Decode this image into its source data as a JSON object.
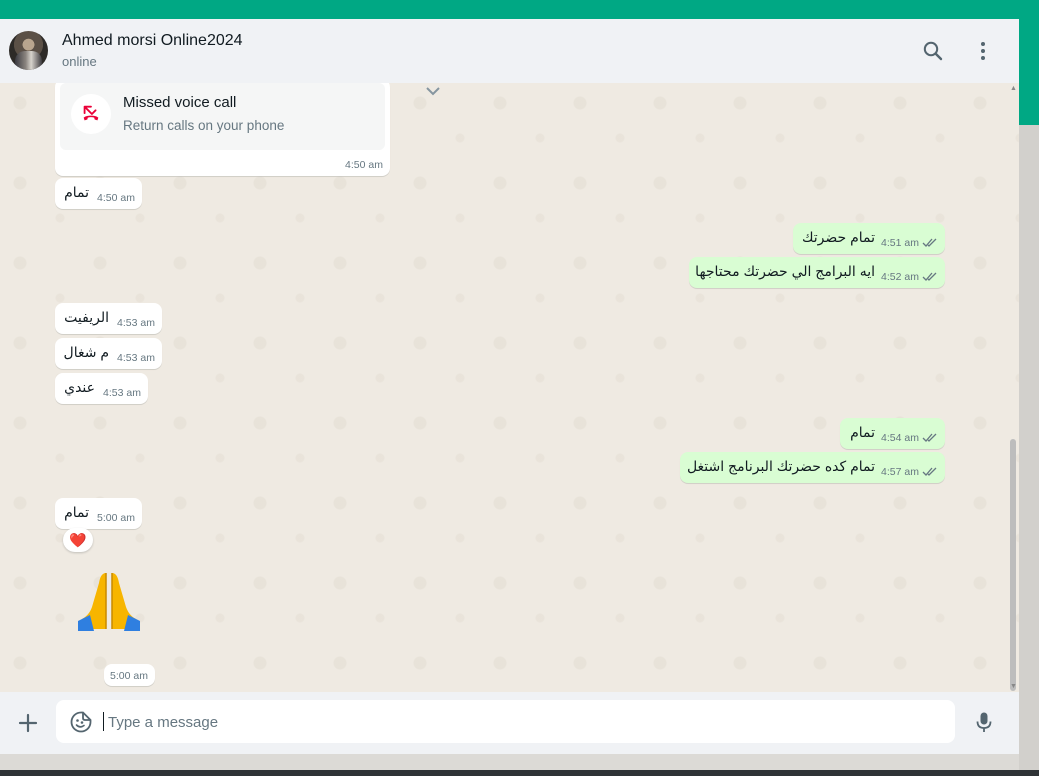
{
  "header": {
    "contact_name": "Ahmed morsi Online2024",
    "status": "online"
  },
  "call": {
    "title": "Missed voice call",
    "subtitle": "Return calls on your phone",
    "time": "4:50 am"
  },
  "messages": [
    {
      "dir": "in",
      "text": "تمام",
      "time": "4:50 am"
    },
    {
      "dir": "out",
      "text": "تمام حضرتك",
      "time": "4:51 am"
    },
    {
      "dir": "out",
      "text": "ايه البرامج الي حضرتك محتاجها",
      "time": "4:52 am"
    },
    {
      "dir": "in",
      "text": "الريفيت",
      "time": "4:53 am"
    },
    {
      "dir": "in",
      "text": "م شغال",
      "time": "4:53 am"
    },
    {
      "dir": "in",
      "text": "عندي",
      "time": "4:53 am"
    },
    {
      "dir": "out",
      "text": "تمام",
      "time": "4:54 am"
    },
    {
      "dir": "out",
      "text": "تمام كده حضرتك البرنامج اشتغل",
      "time": "4:57 am"
    },
    {
      "dir": "in",
      "text": "تمام",
      "time": "5:00 am"
    },
    {
      "dir": "in",
      "text": "",
      "time": "5:00 am"
    }
  ],
  "reaction": "❤️",
  "composer": {
    "placeholder": "Type a message"
  },
  "colors": {
    "accent": "#00a884",
    "outgoing_bubble": "#d9fdd3",
    "incoming_bubble": "#ffffff",
    "read_tick": "#667781"
  },
  "icons": [
    "search-icon",
    "menu-icon",
    "missed-call-icon",
    "chevron-down-icon",
    "plus-icon",
    "sticker-icon",
    "mic-icon",
    "double-tick-icon",
    "folded-hands-emoji"
  ]
}
